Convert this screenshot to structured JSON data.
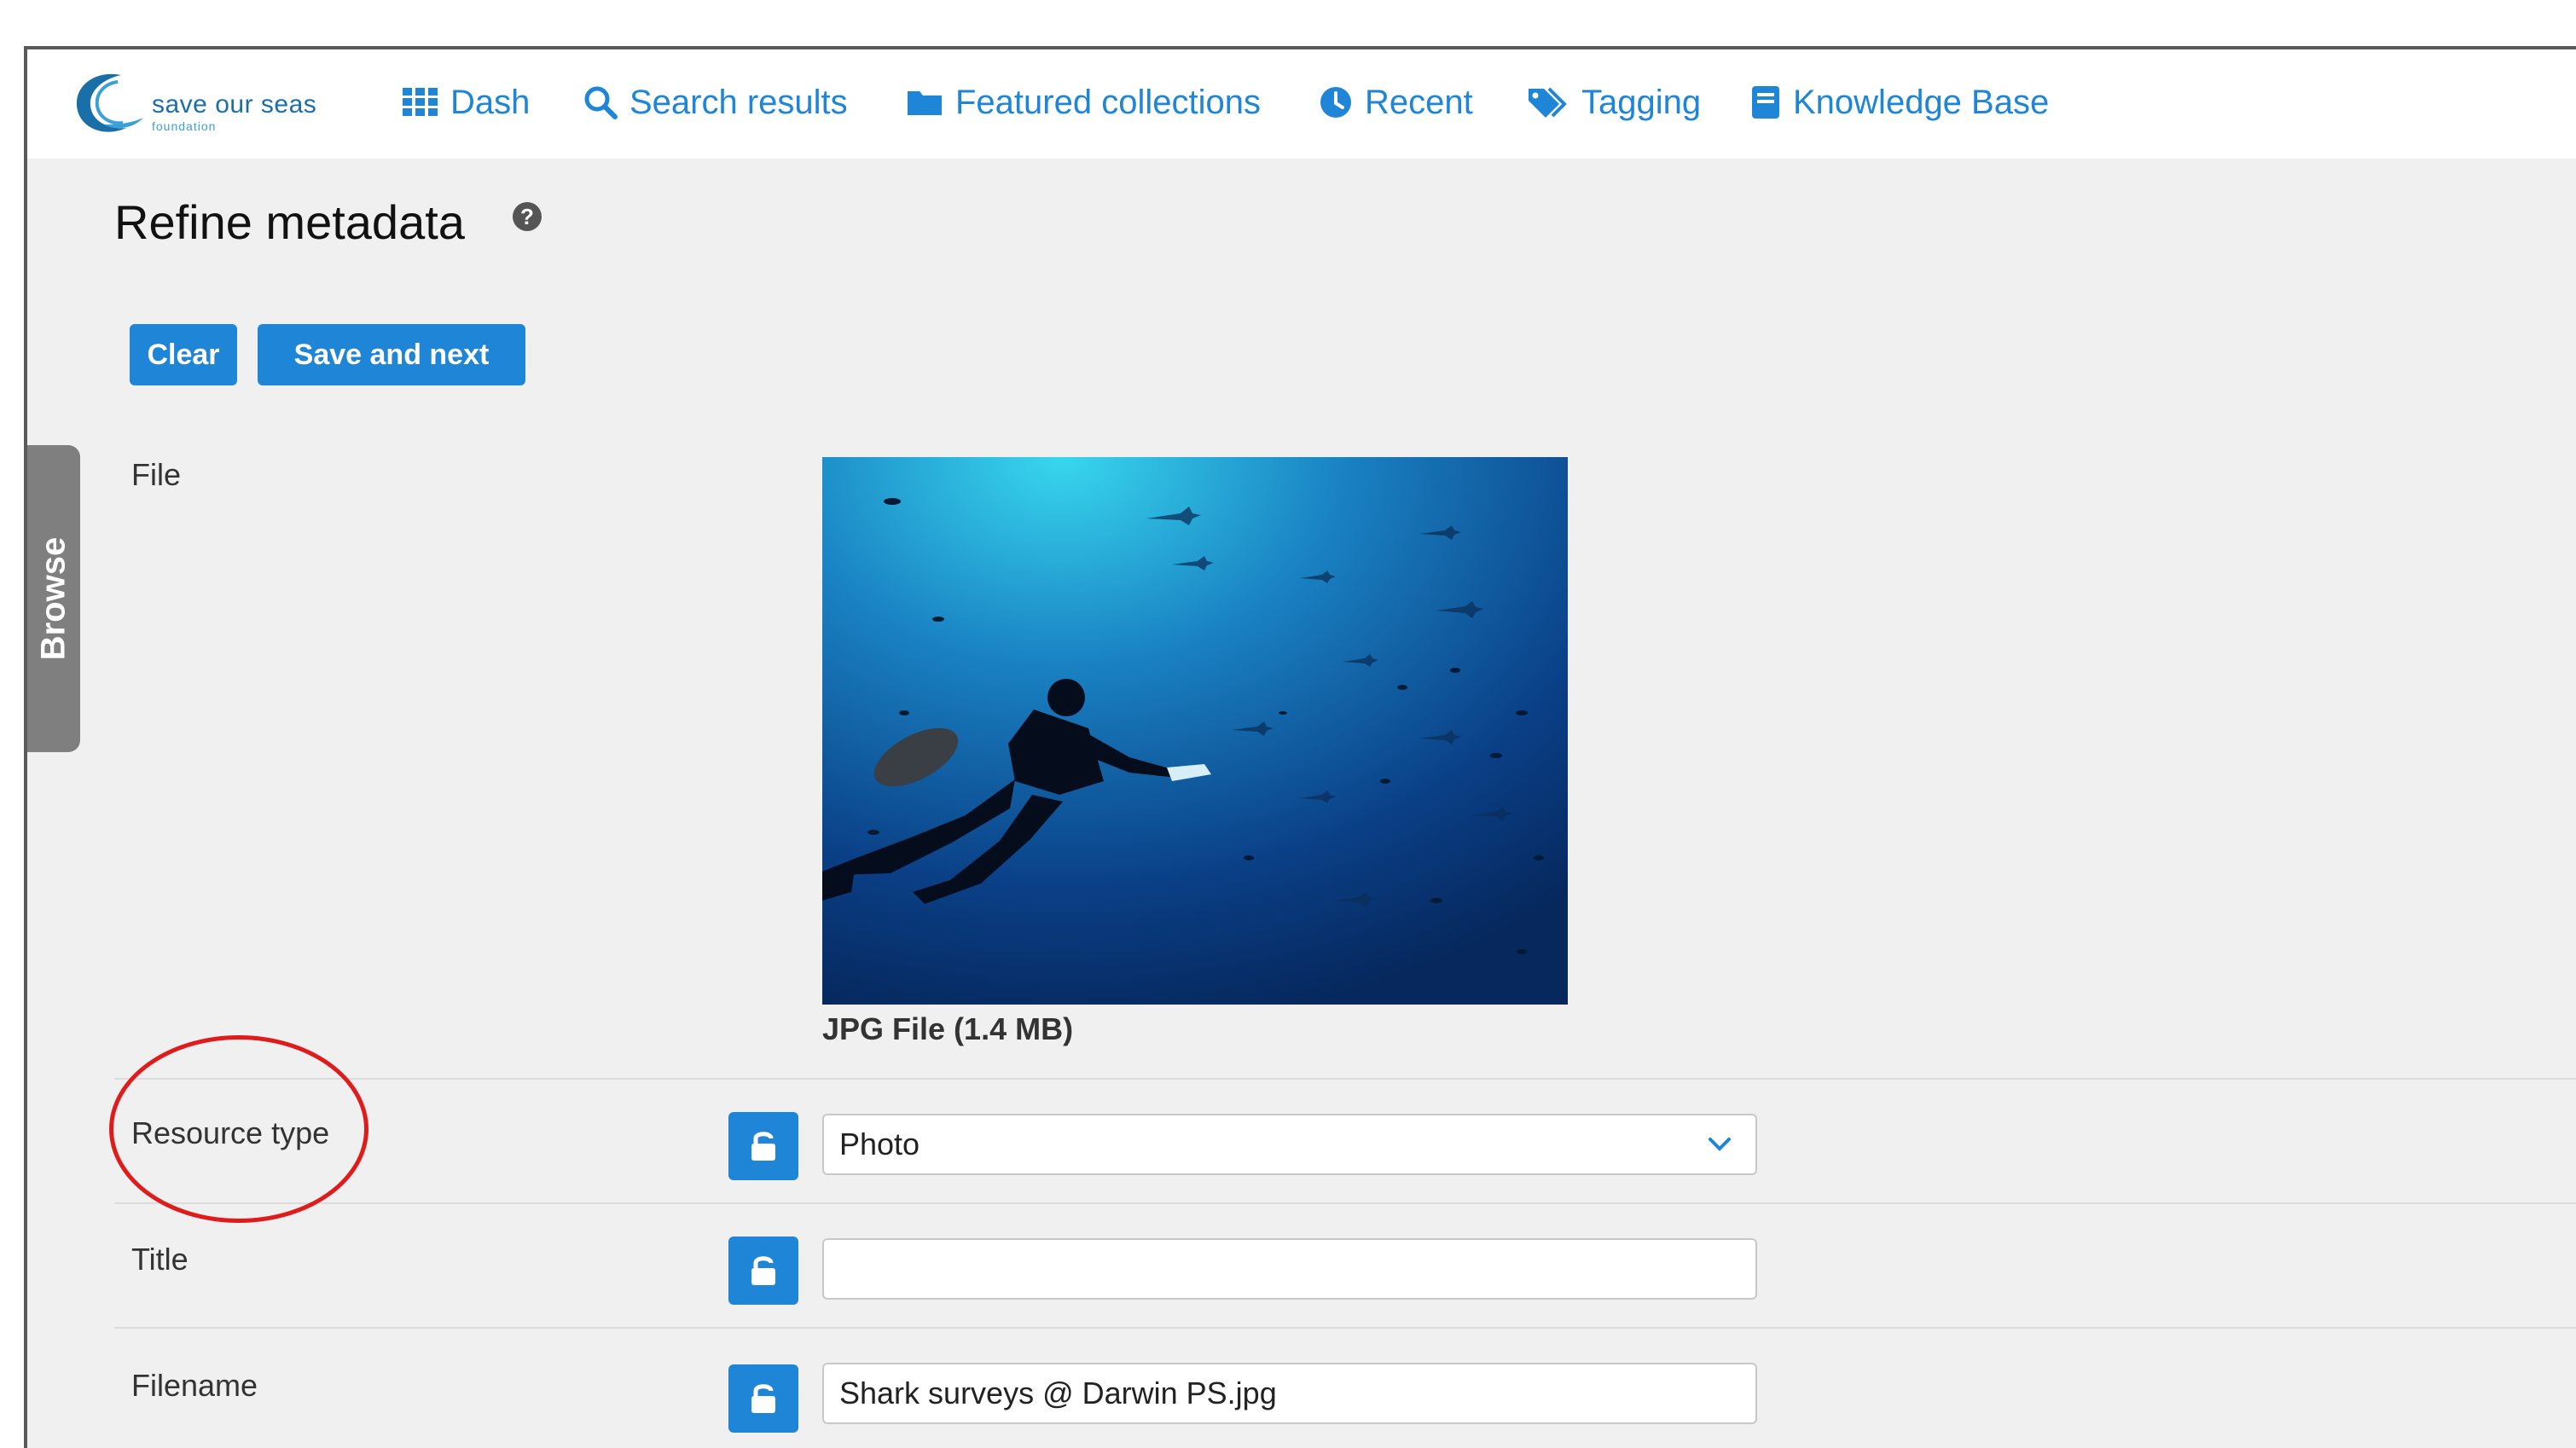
{
  "brand": {
    "name": "save our seas",
    "subtitle": "foundation",
    "color": "#1a6fa8"
  },
  "nav": {
    "items": [
      {
        "label": "Dash",
        "icon": "grid-icon"
      },
      {
        "label": "Search results",
        "icon": "search-icon"
      },
      {
        "label": "Featured collections",
        "icon": "folder-icon"
      },
      {
        "label": "Recent",
        "icon": "clock-icon"
      },
      {
        "label": "Tagging",
        "icon": "tags-icon"
      },
      {
        "label": "Knowledge Base",
        "icon": "book-icon"
      }
    ],
    "link_color": "#1f85d6"
  },
  "sidebar": {
    "browse_label": "Browse"
  },
  "page": {
    "title": "Refine metadata",
    "help_icon": "help-circle-icon"
  },
  "toolbar": {
    "clear_label": "Clear",
    "save_next_label": "Save and next",
    "accent": "#1f85d6"
  },
  "form": {
    "file": {
      "label": "File",
      "info": "JPG File (1.4 MB)"
    },
    "fields": [
      {
        "label": "Resource type",
        "type": "select",
        "value": "Photo",
        "lock_icon": "unlock-icon"
      },
      {
        "label": "Title",
        "type": "text",
        "value": "",
        "lock_icon": "unlock-icon"
      },
      {
        "label": "Filename",
        "type": "text",
        "value": "Shark surveys @ Darwin PS.jpg",
        "lock_icon": "unlock-icon"
      }
    ]
  },
  "annotation": {
    "highlight_color": "#e01b1b"
  }
}
